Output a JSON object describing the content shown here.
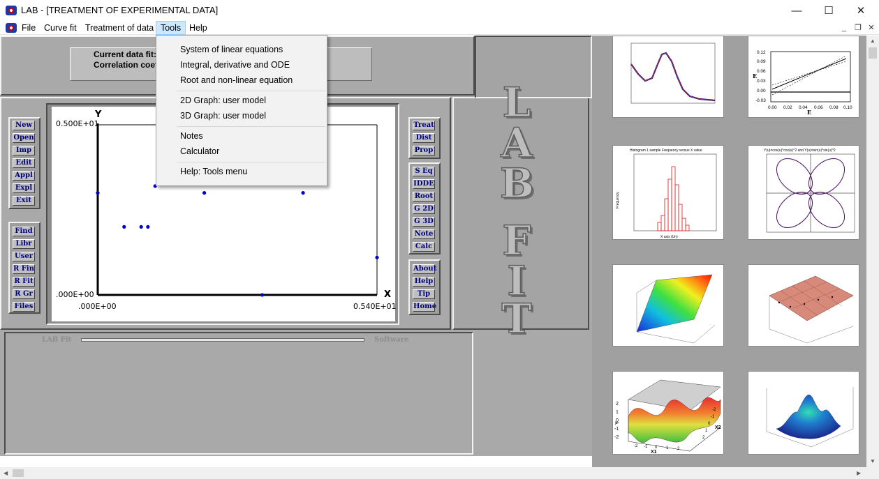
{
  "window": {
    "title": "LAB - [TREATMENT OF EXPERIMENTAL DATA]",
    "min_glyph": "—",
    "max_glyph": "☐",
    "close_glyph": "✕"
  },
  "menubar": {
    "items": [
      "File",
      "Curve fit",
      "Treatment of data",
      "Tools",
      "Help"
    ],
    "mdi_min": "_",
    "mdi_restore": "❐",
    "mdi_close": "✕"
  },
  "tools_menu": {
    "items": [
      "System of linear equations",
      "Integral, derivative and ODE",
      "Root and non-linear equation",
      "2D Graph: user model",
      "3D Graph: user model",
      "Notes",
      "Calculator",
      "Help: Tools menu"
    ]
  },
  "fit_panel": {
    "current_label": "Current data fit:",
    "correlation_label": "Correlation coefficient:"
  },
  "left_buttons": [
    "New",
    "Open",
    "Imp",
    "Edit",
    "Appl",
    "Expl",
    "Exit"
  ],
  "left_buttons2": [
    "Find",
    "Libr",
    "User",
    "R Fin",
    "R Fit",
    "R Gr",
    "Files"
  ],
  "right_buttons1": [
    "Treat",
    "Dist",
    "Prop"
  ],
  "right_buttons2": [
    "S Eq",
    "IDDE",
    "Root",
    "G 2D",
    "G 3D",
    "Note",
    "Calc"
  ],
  "right_buttons3": [
    "About",
    "Help",
    "Tip",
    "Home"
  ],
  "plot": {
    "y_axis_label": "Y",
    "x_axis_label": "X",
    "y_max_label": "0.500E+01",
    "y_min_label": ".000E+00",
    "x_min_label": ".000E+00",
    "x_max_label": "0.540E+01"
  },
  "chart_data": {
    "type": "scatter",
    "xlabel": "X",
    "ylabel": "Y",
    "xlim": [
      0,
      5.4
    ],
    "ylim": [
      0,
      5
    ],
    "x": [
      0.0,
      1.85,
      0.51,
      0.84,
      0.97,
      1.11,
      2.06,
      3.18,
      5.4,
      3.97
    ],
    "y": [
      3.0,
      5.0,
      2.0,
      2.0,
      2.0,
      3.2,
      3.0,
      0.0,
      1.1,
      3.0
    ],
    "point_color": "#0000cc"
  },
  "status_bar": {
    "left": "LAB Fit",
    "right": "Software"
  },
  "brand_letters": [
    "L",
    "A",
    "B",
    "F",
    "I",
    "T"
  ],
  "gallery": {
    "thumbs": [
      {
        "id": "fit-curve"
      },
      {
        "id": "linear-fit"
      },
      {
        "id": "histogram",
        "title": "Histogram 1 sample Frequency versus X value",
        "xlabel": "X axis (Un)",
        "ylabel": "Frequency"
      },
      {
        "id": "rose-curve",
        "title": "Y(u)=cos(u)*cos(u)^2 and Y(u)=sin(u)*sin(u)^2"
      },
      {
        "id": "surface-3d-1"
      },
      {
        "id": "surface-3d-2"
      },
      {
        "id": "surface-3d-3",
        "xlabel": "X1",
        "ylabel": "X2",
        "zlabel": "Y"
      },
      {
        "id": "surface-3d-4"
      }
    ],
    "linear_axis": {
      "y_label": "E",
      "x_label": "E",
      "y_ticks": [
        "0.12",
        "0.09",
        "0.06",
        "0.03",
        "0.00",
        "-0.03"
      ],
      "x_ticks": [
        "0.00",
        "0.02",
        "0.04",
        "0.06",
        "0.08",
        "0.10"
      ]
    },
    "surface_axis": {
      "z_ticks": [
        "2",
        "1",
        "0",
        "-1",
        "-2"
      ],
      "x1_ticks": [
        "-2",
        "-1",
        "0",
        "1",
        "2"
      ],
      "x2_ticks": [
        "-2",
        "-1",
        "0",
        "1",
        "2"
      ]
    }
  },
  "colors": {
    "menu_highlight": "#cce8ff",
    "button_text": "#000080",
    "mdi_background": "#a9a9a9"
  }
}
